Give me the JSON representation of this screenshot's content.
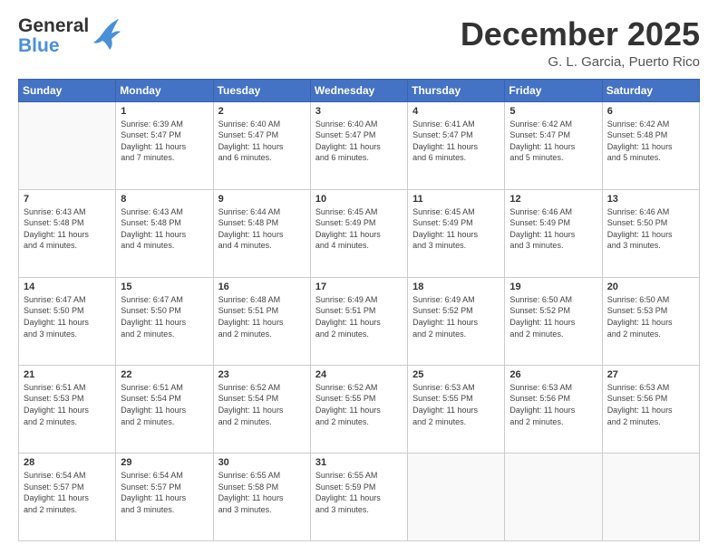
{
  "header": {
    "logo_line1": "General",
    "logo_line2": "Blue",
    "month": "December 2025",
    "location": "G. L. Garcia, Puerto Rico"
  },
  "weekdays": [
    "Sunday",
    "Monday",
    "Tuesday",
    "Wednesday",
    "Thursday",
    "Friday",
    "Saturday"
  ],
  "weeks": [
    [
      {
        "day": "",
        "info": ""
      },
      {
        "day": "1",
        "info": "Sunrise: 6:39 AM\nSunset: 5:47 PM\nDaylight: 11 hours\nand 7 minutes."
      },
      {
        "day": "2",
        "info": "Sunrise: 6:40 AM\nSunset: 5:47 PM\nDaylight: 11 hours\nand 6 minutes."
      },
      {
        "day": "3",
        "info": "Sunrise: 6:40 AM\nSunset: 5:47 PM\nDaylight: 11 hours\nand 6 minutes."
      },
      {
        "day": "4",
        "info": "Sunrise: 6:41 AM\nSunset: 5:47 PM\nDaylight: 11 hours\nand 6 minutes."
      },
      {
        "day": "5",
        "info": "Sunrise: 6:42 AM\nSunset: 5:47 PM\nDaylight: 11 hours\nand 5 minutes."
      },
      {
        "day": "6",
        "info": "Sunrise: 6:42 AM\nSunset: 5:48 PM\nDaylight: 11 hours\nand 5 minutes."
      }
    ],
    [
      {
        "day": "7",
        "info": "Sunrise: 6:43 AM\nSunset: 5:48 PM\nDaylight: 11 hours\nand 4 minutes."
      },
      {
        "day": "8",
        "info": "Sunrise: 6:43 AM\nSunset: 5:48 PM\nDaylight: 11 hours\nand 4 minutes."
      },
      {
        "day": "9",
        "info": "Sunrise: 6:44 AM\nSunset: 5:48 PM\nDaylight: 11 hours\nand 4 minutes."
      },
      {
        "day": "10",
        "info": "Sunrise: 6:45 AM\nSunset: 5:49 PM\nDaylight: 11 hours\nand 4 minutes."
      },
      {
        "day": "11",
        "info": "Sunrise: 6:45 AM\nSunset: 5:49 PM\nDaylight: 11 hours\nand 3 minutes."
      },
      {
        "day": "12",
        "info": "Sunrise: 6:46 AM\nSunset: 5:49 PM\nDaylight: 11 hours\nand 3 minutes."
      },
      {
        "day": "13",
        "info": "Sunrise: 6:46 AM\nSunset: 5:50 PM\nDaylight: 11 hours\nand 3 minutes."
      }
    ],
    [
      {
        "day": "14",
        "info": "Sunrise: 6:47 AM\nSunset: 5:50 PM\nDaylight: 11 hours\nand 3 minutes."
      },
      {
        "day": "15",
        "info": "Sunrise: 6:47 AM\nSunset: 5:50 PM\nDaylight: 11 hours\nand 2 minutes."
      },
      {
        "day": "16",
        "info": "Sunrise: 6:48 AM\nSunset: 5:51 PM\nDaylight: 11 hours\nand 2 minutes."
      },
      {
        "day": "17",
        "info": "Sunrise: 6:49 AM\nSunset: 5:51 PM\nDaylight: 11 hours\nand 2 minutes."
      },
      {
        "day": "18",
        "info": "Sunrise: 6:49 AM\nSunset: 5:52 PM\nDaylight: 11 hours\nand 2 minutes."
      },
      {
        "day": "19",
        "info": "Sunrise: 6:50 AM\nSunset: 5:52 PM\nDaylight: 11 hours\nand 2 minutes."
      },
      {
        "day": "20",
        "info": "Sunrise: 6:50 AM\nSunset: 5:53 PM\nDaylight: 11 hours\nand 2 minutes."
      }
    ],
    [
      {
        "day": "21",
        "info": "Sunrise: 6:51 AM\nSunset: 5:53 PM\nDaylight: 11 hours\nand 2 minutes."
      },
      {
        "day": "22",
        "info": "Sunrise: 6:51 AM\nSunset: 5:54 PM\nDaylight: 11 hours\nand 2 minutes."
      },
      {
        "day": "23",
        "info": "Sunrise: 6:52 AM\nSunset: 5:54 PM\nDaylight: 11 hours\nand 2 minutes."
      },
      {
        "day": "24",
        "info": "Sunrise: 6:52 AM\nSunset: 5:55 PM\nDaylight: 11 hours\nand 2 minutes."
      },
      {
        "day": "25",
        "info": "Sunrise: 6:53 AM\nSunset: 5:55 PM\nDaylight: 11 hours\nand 2 minutes."
      },
      {
        "day": "26",
        "info": "Sunrise: 6:53 AM\nSunset: 5:56 PM\nDaylight: 11 hours\nand 2 minutes."
      },
      {
        "day": "27",
        "info": "Sunrise: 6:53 AM\nSunset: 5:56 PM\nDaylight: 11 hours\nand 2 minutes."
      }
    ],
    [
      {
        "day": "28",
        "info": "Sunrise: 6:54 AM\nSunset: 5:57 PM\nDaylight: 11 hours\nand 2 minutes."
      },
      {
        "day": "29",
        "info": "Sunrise: 6:54 AM\nSunset: 5:57 PM\nDaylight: 11 hours\nand 3 minutes."
      },
      {
        "day": "30",
        "info": "Sunrise: 6:55 AM\nSunset: 5:58 PM\nDaylight: 11 hours\nand 3 minutes."
      },
      {
        "day": "31",
        "info": "Sunrise: 6:55 AM\nSunset: 5:59 PM\nDaylight: 11 hours\nand 3 minutes."
      },
      {
        "day": "",
        "info": ""
      },
      {
        "day": "",
        "info": ""
      },
      {
        "day": "",
        "info": ""
      }
    ]
  ]
}
